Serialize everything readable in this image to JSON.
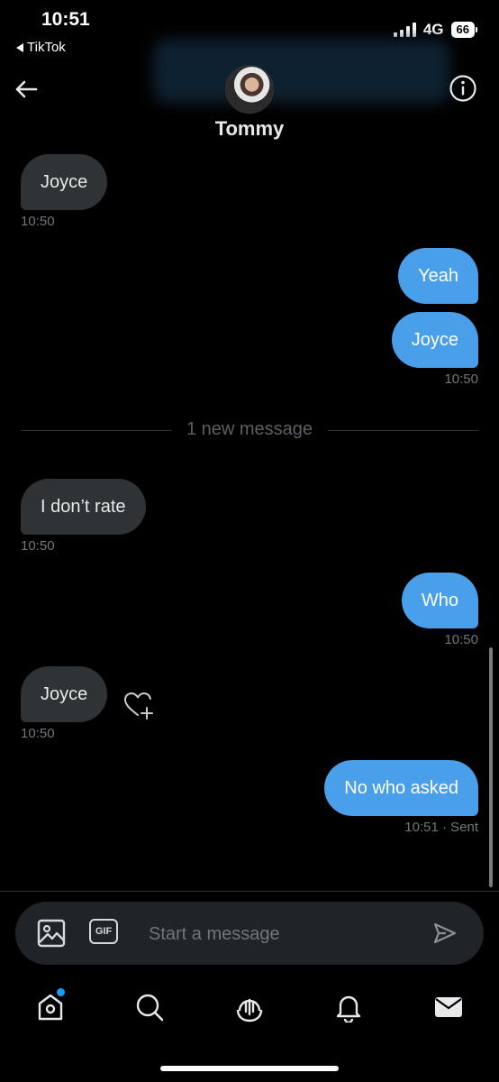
{
  "status_bar": {
    "time": "10:51",
    "back_app": "TikTok",
    "network": "4G",
    "battery": "66"
  },
  "header": {
    "contact_name": "Tommy"
  },
  "messages": [
    {
      "text": "Joyce",
      "time": "10:50",
      "direction": "incoming"
    },
    {
      "text": "Yeah",
      "direction": "outgoing"
    },
    {
      "text": "Joyce",
      "time": "10:50",
      "direction": "outgoing"
    },
    {
      "text": "I don’t rate",
      "time": "10:50",
      "direction": "incoming"
    },
    {
      "text": "Who",
      "time": "10:50",
      "direction": "outgoing"
    },
    {
      "text": "Joyce",
      "time": "10:50",
      "direction": "incoming"
    },
    {
      "text": "No who asked",
      "time": "10:51 · Sent",
      "direction": "outgoing"
    }
  ],
  "divider": {
    "label": "1 new message"
  },
  "composer": {
    "placeholder": "Start a message",
    "gif_label": "GIF"
  },
  "colors": {
    "background": "#000000",
    "incoming_bubble": "#2f3336",
    "outgoing_bubble": "#4a9fea",
    "accent": "#1d9bf0"
  },
  "tab_icons": [
    "home-icon",
    "search-icon",
    "spaces-icon",
    "notifications-icon",
    "messages-icon"
  ]
}
